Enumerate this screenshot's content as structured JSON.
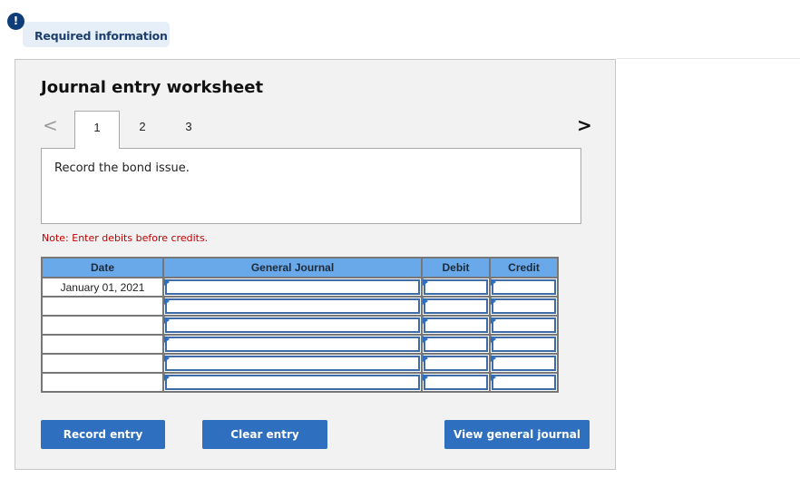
{
  "required_info": {
    "icon": "exclamation-icon",
    "icon_glyph": "!",
    "label": "Required information"
  },
  "worksheet": {
    "title": "Journal entry worksheet",
    "nav": {
      "prev_glyph": "<",
      "next_glyph": ">"
    },
    "tabs": [
      {
        "label": "1",
        "active": true
      },
      {
        "label": "2",
        "active": false
      },
      {
        "label": "3",
        "active": false
      }
    ],
    "instruction": "Record the bond issue.",
    "note": "Note: Enter debits before credits.",
    "table": {
      "columns": [
        "Date",
        "General Journal",
        "Debit",
        "Credit"
      ],
      "rows": [
        {
          "date": "January 01, 2021",
          "account": "",
          "debit": "",
          "credit": ""
        },
        {
          "date": "",
          "account": "",
          "debit": "",
          "credit": ""
        },
        {
          "date": "",
          "account": "",
          "debit": "",
          "credit": ""
        },
        {
          "date": "",
          "account": "",
          "debit": "",
          "credit": ""
        },
        {
          "date": "",
          "account": "",
          "debit": "",
          "credit": ""
        },
        {
          "date": "",
          "account": "",
          "debit": "",
          "credit": ""
        }
      ]
    },
    "buttons": {
      "record": "Record entry",
      "clear": "Clear entry",
      "view": "View general journal"
    }
  },
  "colors": {
    "accent": "#2e6fbf",
    "header_blue": "#6aa9e9",
    "note_red": "#c00000",
    "badge_bg": "#e6eef7",
    "badge_icon": "#0e3d7a"
  }
}
